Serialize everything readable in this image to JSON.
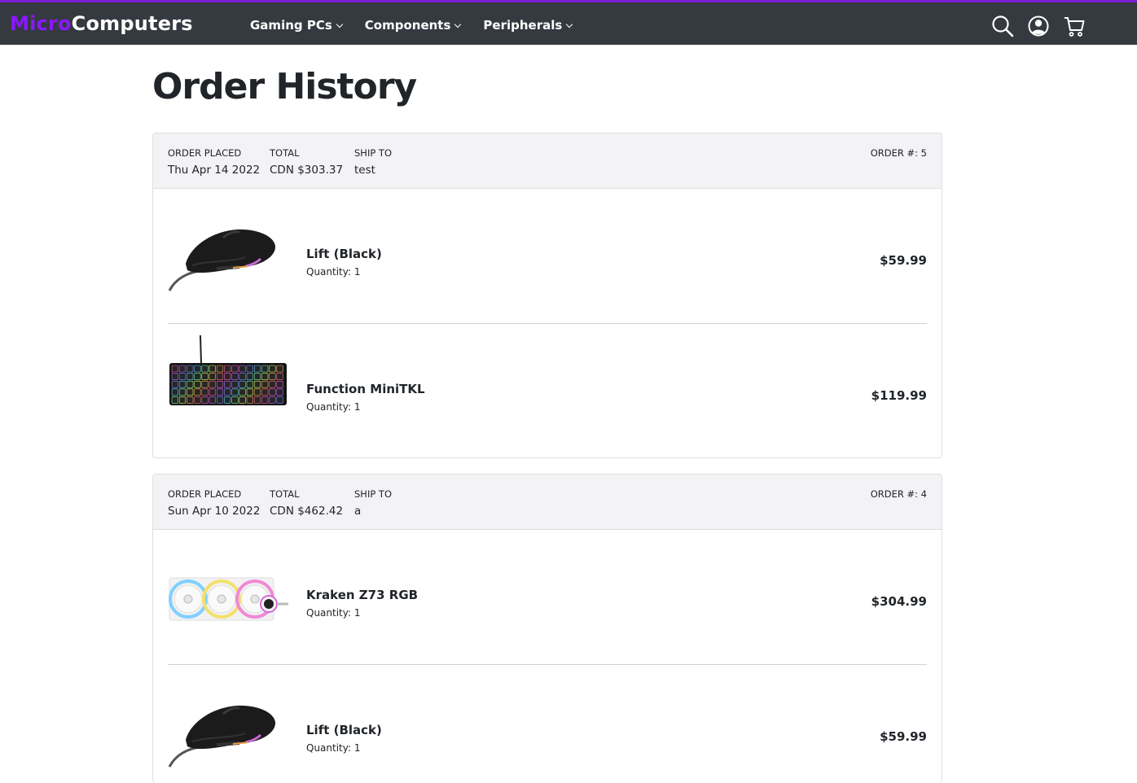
{
  "brand": {
    "part1": "Micro",
    "part2": "Computers",
    "accent": "#8a17ff",
    "nav_bg": "#343a40",
    "nav_top_border": "#7c1fd4"
  },
  "nav": {
    "links": [
      "Gaming PCs",
      "Components",
      "Peripherals"
    ],
    "icons": [
      "search-icon",
      "account-icon",
      "cart-icon"
    ]
  },
  "page": {
    "title": "Order History"
  },
  "labels": {
    "order_placed": "ORDER PLACED",
    "total": "TOTAL",
    "ship_to": "SHIP TO",
    "order_num": "ORDER #:"
  },
  "orders": [
    {
      "placed": "Thu Apr 14 2022",
      "total": "CDN $303.37",
      "ship_to": "test",
      "number": "5",
      "items": [
        {
          "name": "Lift (Black)",
          "quantity": "Quantity: 1",
          "price": "$59.99",
          "image": "mouse-image"
        },
        {
          "name": "Function MiniTKL",
          "quantity": "Quantity: 1",
          "price": "$119.99",
          "image": "keyboard-image"
        }
      ]
    },
    {
      "placed": "Sun Apr 10 2022",
      "total": "CDN $462.42",
      "ship_to": "a",
      "number": "4",
      "items": [
        {
          "name": "Kraken Z73 RGB",
          "quantity": "Quantity: 1",
          "price": "$304.99",
          "image": "cooler-image"
        },
        {
          "name": "Lift (Black)",
          "quantity": "Quantity: 1",
          "price": "$59.99",
          "image": "mouse-image"
        }
      ]
    }
  ]
}
